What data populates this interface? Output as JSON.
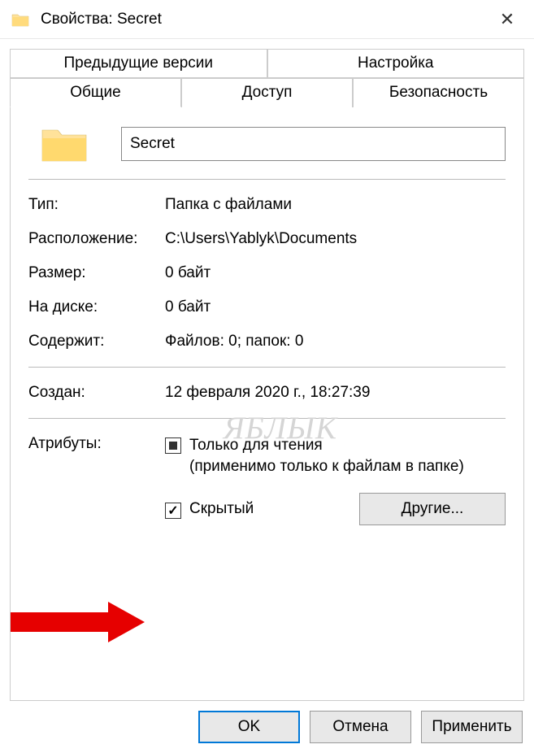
{
  "window": {
    "title": "Свойства: Secret"
  },
  "tabs": {
    "previous_versions": "Предыдущие версии",
    "customize": "Настройка",
    "general": "Общие",
    "sharing": "Доступ",
    "security": "Безопасность"
  },
  "folder": {
    "name": "Secret"
  },
  "labels": {
    "type": "Тип:",
    "location": "Расположение:",
    "size": "Размер:",
    "size_on_disk": "На диске:",
    "contains": "Содержит:",
    "created": "Создан:",
    "attributes": "Атрибуты:"
  },
  "values": {
    "type": "Папка с файлами",
    "location": "C:\\Users\\Yablyk\\Documents",
    "size": "0 байт",
    "size_on_disk": "0 байт",
    "contains": "Файлов: 0; папок: 0",
    "created": "12 февраля 2020 г., 18:27:39"
  },
  "attributes": {
    "readonly_label": "Только для чтения",
    "readonly_note": "(применимо только к файлам в папке)",
    "hidden_label": "Скрытый",
    "other_button": "Другие..."
  },
  "buttons": {
    "ok": "OK",
    "cancel": "Отмена",
    "apply": "Применить"
  },
  "watermark": "ЯБЛЫК"
}
